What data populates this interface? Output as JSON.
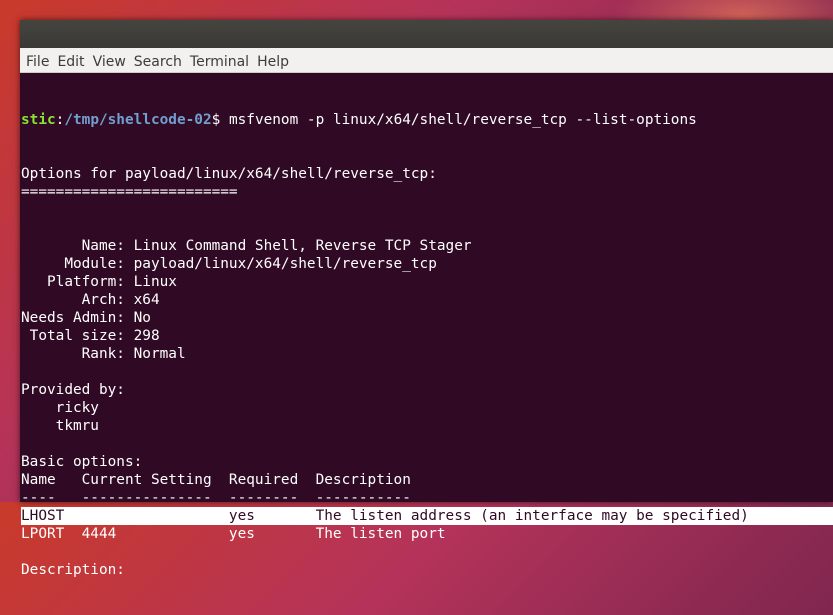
{
  "window": {
    "menu": [
      "File",
      "Edit",
      "View",
      "Search",
      "Terminal",
      "Help"
    ]
  },
  "terminal": {
    "prompt_user": "stic",
    "prompt_sep": ":",
    "prompt_path": "/tmp/shellcode-02",
    "prompt_end": "$ ",
    "command": "msfvenom -p linux/x64/shell/reverse_tcp --list-options",
    "lines": [
      "Options for payload/linux/x64/shell/reverse_tcp:",
      "=========================",
      "",
      "",
      "       Name: Linux Command Shell, Reverse TCP Stager",
      "     Module: payload/linux/x64/shell/reverse_tcp",
      "   Platform: Linux",
      "       Arch: x64",
      "Needs Admin: No",
      " Total size: 298",
      "       Rank: Normal",
      "",
      "Provided by:",
      "    ricky",
      "    tkmru",
      "",
      "Basic options:",
      "Name   Current Setting  Required  Description",
      "----   ---------------  --------  -----------",
      "LHOST                   yes       The listen address (an interface may be specified)",
      "LPORT  4444             yes       The listen port",
      "",
      "Description:"
    ],
    "highlighted_line": "LHOST                   yes       The listen address (an interface may be specified)"
  },
  "colors": {
    "terminal_bg": "#300a24",
    "prompt_user": "#8ae234",
    "prompt_path": "#729fcf",
    "text": "#ffffff"
  }
}
